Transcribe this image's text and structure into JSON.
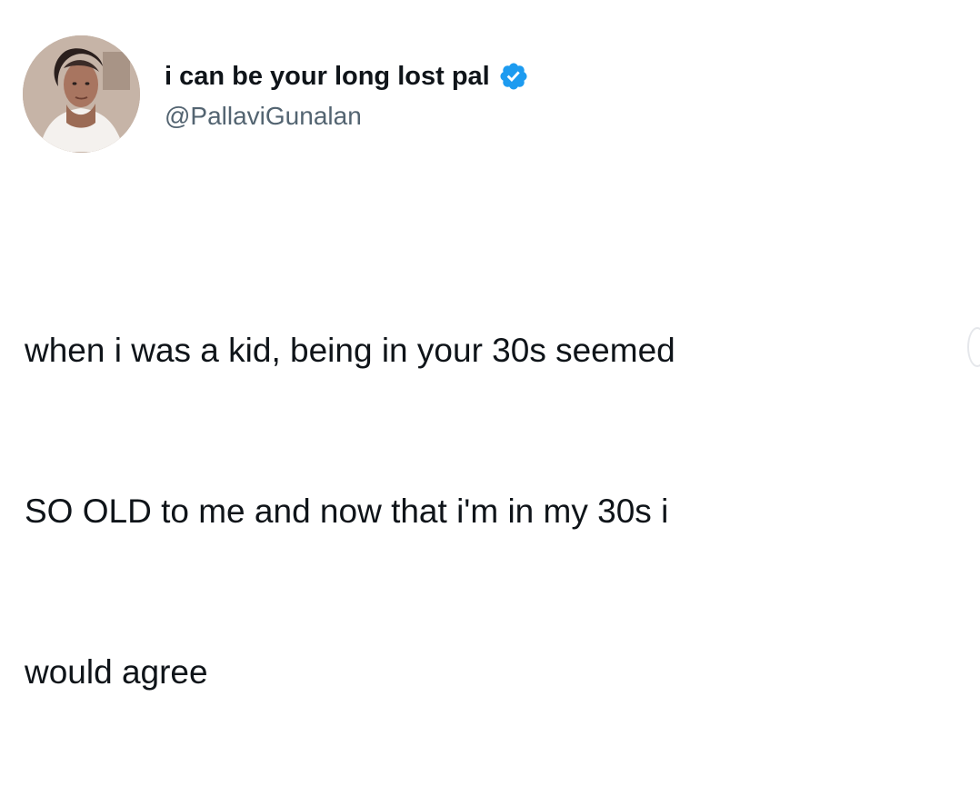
{
  "tweet": {
    "author": {
      "display_name": "i can be your long lost pal",
      "handle": "@PallaviGunalan",
      "verified": true,
      "verified_icon": "verified-badge-icon",
      "avatar": "profile-photo"
    },
    "text_lines": [
      "when i was a kid, being in your 30s seemed",
      "SO OLD to me and now that i'm in my 30s i",
      "would agree"
    ],
    "colors": {
      "name": "#0f1419",
      "handle": "#536471",
      "verified": "#1d9bf0",
      "background": "#ffffff"
    }
  }
}
